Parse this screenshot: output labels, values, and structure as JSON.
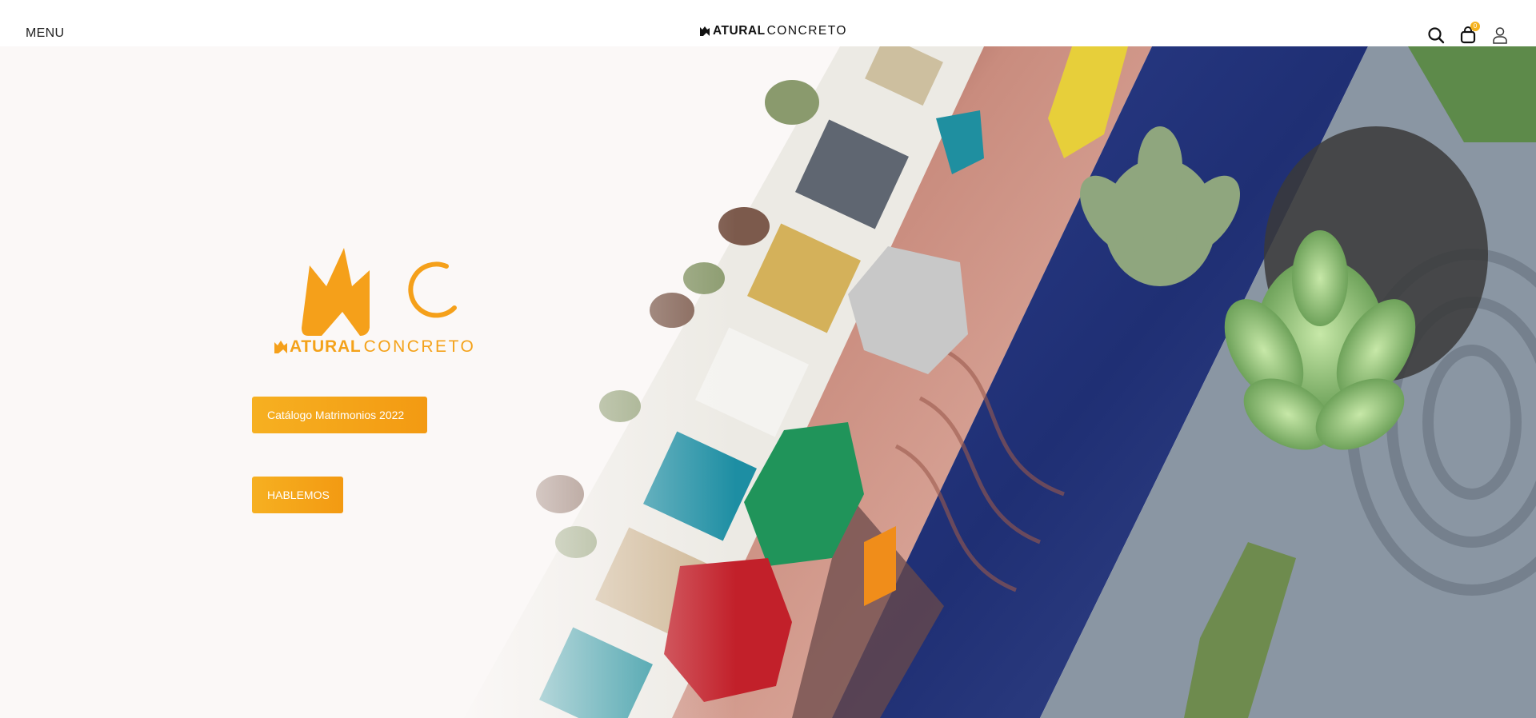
{
  "header": {
    "menu_label": "MENU",
    "brand_bold": "ATURAL",
    "brand_light": "CONCRETO",
    "cart_count": "0",
    "icons": [
      "search-icon",
      "shopping-bag-icon",
      "user-icon"
    ]
  },
  "hero": {
    "logo_bold": "ATURAL",
    "logo_light": "CONCRETO",
    "cta_catalog": "Catálogo Matrimonios 2022",
    "cta_talk": "HABLEMOS"
  },
  "colors": {
    "accent": "#f5a01a",
    "header_bg": "#ffffff",
    "page_bg": "#fbf8f7"
  }
}
